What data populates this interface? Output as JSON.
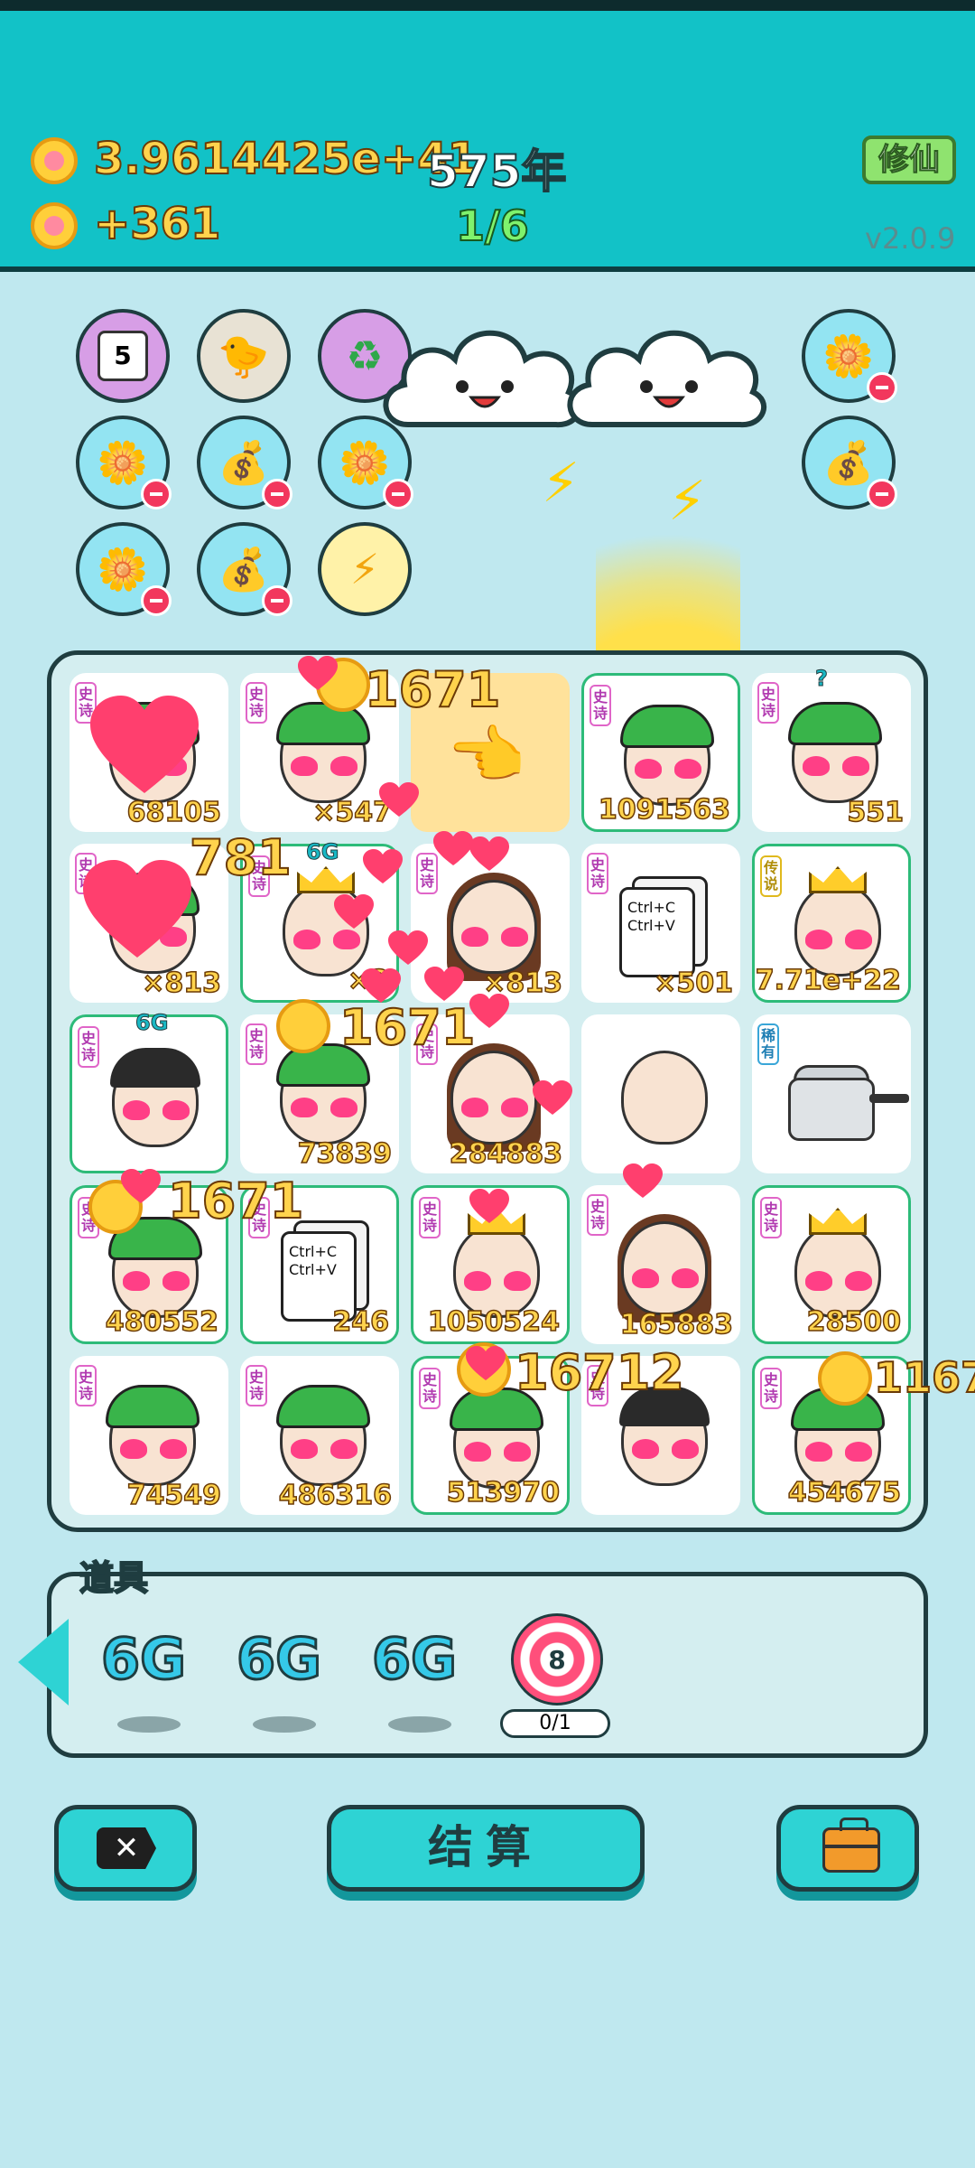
{
  "header": {
    "currency_total": "3.9614425e+41",
    "income_rate": "+361",
    "year": "575年",
    "progress": "1/6",
    "mode_button": "修仙",
    "version": "v2.0.9"
  },
  "items_row": {
    "calendar_day": "5"
  },
  "floating_numbers": [
    "1671",
    "781",
    "1671",
    "1671",
    "16712",
    "1167"
  ],
  "board": {
    "cells": [
      {
        "tag": "史诗",
        "value": "68105"
      },
      {
        "tag": "史诗",
        "value": "×547"
      },
      {
        "tag": "",
        "value": ""
      },
      {
        "tag": "史诗",
        "value": "1091563"
      },
      {
        "tag": "史诗",
        "value": "551",
        "badge": "?"
      },
      {
        "tag": "史诗",
        "value": "×813"
      },
      {
        "tag": "史诗",
        "value": "×3",
        "badge": "6G"
      },
      {
        "tag": "史诗",
        "value": "×813"
      },
      {
        "tag": "史诗",
        "value": "×501",
        "ctrl_text": [
          "Ctrl+C",
          "Ctrl+V"
        ]
      },
      {
        "tag": "传说",
        "value": "7.71e+22"
      },
      {
        "tag": "史诗",
        "value": "",
        "badge": "6G"
      },
      {
        "tag": "史诗",
        "value": "73839"
      },
      {
        "tag": "史诗",
        "value": "284883"
      },
      {
        "tag": "",
        "value": ""
      },
      {
        "tag": "稀有",
        "value": ""
      },
      {
        "tag": "史诗",
        "value": "480552"
      },
      {
        "tag": "史诗",
        "value": "246",
        "ctrl_text": [
          "Ctrl+C",
          "Ctrl+V"
        ]
      },
      {
        "tag": "史诗",
        "value": "1050524"
      },
      {
        "tag": "史诗",
        "value": "165883"
      },
      {
        "tag": "史诗",
        "value": "28500"
      },
      {
        "tag": "史诗",
        "value": "74549"
      },
      {
        "tag": "史诗",
        "value": "486316"
      },
      {
        "tag": "史诗",
        "value": "513970"
      },
      {
        "tag": "史诗",
        "value": ""
      },
      {
        "tag": "史诗",
        "value": "454675"
      }
    ]
  },
  "tools": {
    "label": "道具",
    "items": [
      {
        "name": "6G"
      },
      {
        "name": "6G"
      },
      {
        "name": "6G"
      }
    ],
    "target_number": "8",
    "target_count": "0/1"
  },
  "bottom": {
    "settle_label": "结算"
  },
  "colors": {
    "accent": "#12c2c7",
    "gold": "#ffd34d",
    "epic_tag": "#e065c8",
    "rare_tag": "#39a6d8"
  }
}
